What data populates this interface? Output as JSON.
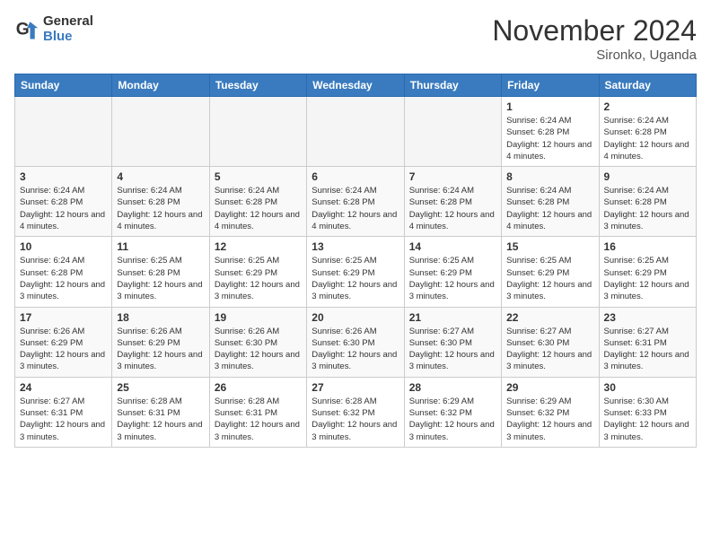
{
  "logo": {
    "general": "General",
    "blue": "Blue"
  },
  "title": "November 2024",
  "subtitle": "Sironko, Uganda",
  "weekdays": [
    "Sunday",
    "Monday",
    "Tuesday",
    "Wednesday",
    "Thursday",
    "Friday",
    "Saturday"
  ],
  "weeks": [
    [
      {
        "day": "",
        "info": ""
      },
      {
        "day": "",
        "info": ""
      },
      {
        "day": "",
        "info": ""
      },
      {
        "day": "",
        "info": ""
      },
      {
        "day": "",
        "info": ""
      },
      {
        "day": "1",
        "info": "Sunrise: 6:24 AM\nSunset: 6:28 PM\nDaylight: 12 hours and 4 minutes."
      },
      {
        "day": "2",
        "info": "Sunrise: 6:24 AM\nSunset: 6:28 PM\nDaylight: 12 hours and 4 minutes."
      }
    ],
    [
      {
        "day": "3",
        "info": "Sunrise: 6:24 AM\nSunset: 6:28 PM\nDaylight: 12 hours and 4 minutes."
      },
      {
        "day": "4",
        "info": "Sunrise: 6:24 AM\nSunset: 6:28 PM\nDaylight: 12 hours and 4 minutes."
      },
      {
        "day": "5",
        "info": "Sunrise: 6:24 AM\nSunset: 6:28 PM\nDaylight: 12 hours and 4 minutes."
      },
      {
        "day": "6",
        "info": "Sunrise: 6:24 AM\nSunset: 6:28 PM\nDaylight: 12 hours and 4 minutes."
      },
      {
        "day": "7",
        "info": "Sunrise: 6:24 AM\nSunset: 6:28 PM\nDaylight: 12 hours and 4 minutes."
      },
      {
        "day": "8",
        "info": "Sunrise: 6:24 AM\nSunset: 6:28 PM\nDaylight: 12 hours and 4 minutes."
      },
      {
        "day": "9",
        "info": "Sunrise: 6:24 AM\nSunset: 6:28 PM\nDaylight: 12 hours and 3 minutes."
      }
    ],
    [
      {
        "day": "10",
        "info": "Sunrise: 6:24 AM\nSunset: 6:28 PM\nDaylight: 12 hours and 3 minutes."
      },
      {
        "day": "11",
        "info": "Sunrise: 6:25 AM\nSunset: 6:28 PM\nDaylight: 12 hours and 3 minutes."
      },
      {
        "day": "12",
        "info": "Sunrise: 6:25 AM\nSunset: 6:29 PM\nDaylight: 12 hours and 3 minutes."
      },
      {
        "day": "13",
        "info": "Sunrise: 6:25 AM\nSunset: 6:29 PM\nDaylight: 12 hours and 3 minutes."
      },
      {
        "day": "14",
        "info": "Sunrise: 6:25 AM\nSunset: 6:29 PM\nDaylight: 12 hours and 3 minutes."
      },
      {
        "day": "15",
        "info": "Sunrise: 6:25 AM\nSunset: 6:29 PM\nDaylight: 12 hours and 3 minutes."
      },
      {
        "day": "16",
        "info": "Sunrise: 6:25 AM\nSunset: 6:29 PM\nDaylight: 12 hours and 3 minutes."
      }
    ],
    [
      {
        "day": "17",
        "info": "Sunrise: 6:26 AM\nSunset: 6:29 PM\nDaylight: 12 hours and 3 minutes."
      },
      {
        "day": "18",
        "info": "Sunrise: 6:26 AM\nSunset: 6:29 PM\nDaylight: 12 hours and 3 minutes."
      },
      {
        "day": "19",
        "info": "Sunrise: 6:26 AM\nSunset: 6:30 PM\nDaylight: 12 hours and 3 minutes."
      },
      {
        "day": "20",
        "info": "Sunrise: 6:26 AM\nSunset: 6:30 PM\nDaylight: 12 hours and 3 minutes."
      },
      {
        "day": "21",
        "info": "Sunrise: 6:27 AM\nSunset: 6:30 PM\nDaylight: 12 hours and 3 minutes."
      },
      {
        "day": "22",
        "info": "Sunrise: 6:27 AM\nSunset: 6:30 PM\nDaylight: 12 hours and 3 minutes."
      },
      {
        "day": "23",
        "info": "Sunrise: 6:27 AM\nSunset: 6:31 PM\nDaylight: 12 hours and 3 minutes."
      }
    ],
    [
      {
        "day": "24",
        "info": "Sunrise: 6:27 AM\nSunset: 6:31 PM\nDaylight: 12 hours and 3 minutes."
      },
      {
        "day": "25",
        "info": "Sunrise: 6:28 AM\nSunset: 6:31 PM\nDaylight: 12 hours and 3 minutes."
      },
      {
        "day": "26",
        "info": "Sunrise: 6:28 AM\nSunset: 6:31 PM\nDaylight: 12 hours and 3 minutes."
      },
      {
        "day": "27",
        "info": "Sunrise: 6:28 AM\nSunset: 6:32 PM\nDaylight: 12 hours and 3 minutes."
      },
      {
        "day": "28",
        "info": "Sunrise: 6:29 AM\nSunset: 6:32 PM\nDaylight: 12 hours and 3 minutes."
      },
      {
        "day": "29",
        "info": "Sunrise: 6:29 AM\nSunset: 6:32 PM\nDaylight: 12 hours and 3 minutes."
      },
      {
        "day": "30",
        "info": "Sunrise: 6:30 AM\nSunset: 6:33 PM\nDaylight: 12 hours and 3 minutes."
      }
    ]
  ]
}
